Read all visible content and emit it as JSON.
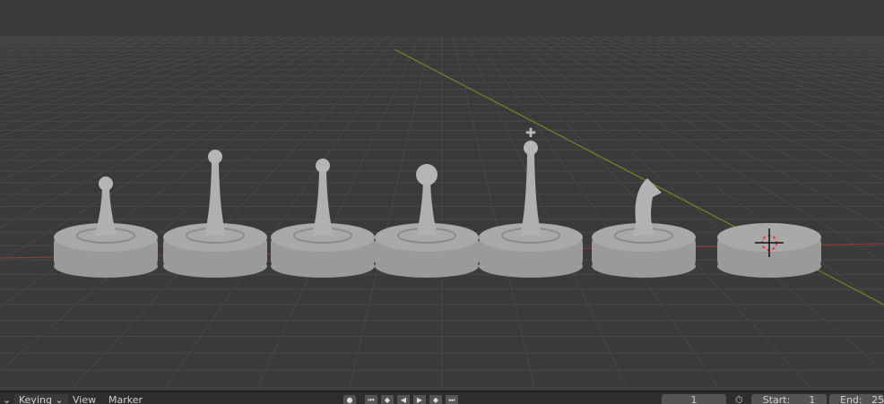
{
  "viewport": {
    "pieces": [
      "pawn",
      "queen",
      "bishop",
      "rook",
      "king",
      "knight",
      "empty-base"
    ],
    "colors": {
      "background": "#3a3a3a",
      "grid": "#474747",
      "x_axis": "#8a3b3b",
      "y_axis": "#6b8a2a",
      "piece": "#a9a9a9"
    }
  },
  "timeline": {
    "menu_dropdown_arrow": "⌄",
    "keying_label": "Keying",
    "view_label": "View",
    "marker_label": "Marker",
    "current_frame": "1",
    "start_label": "Start:",
    "start_value": "1",
    "end_label": "End:",
    "end_value": "25"
  }
}
